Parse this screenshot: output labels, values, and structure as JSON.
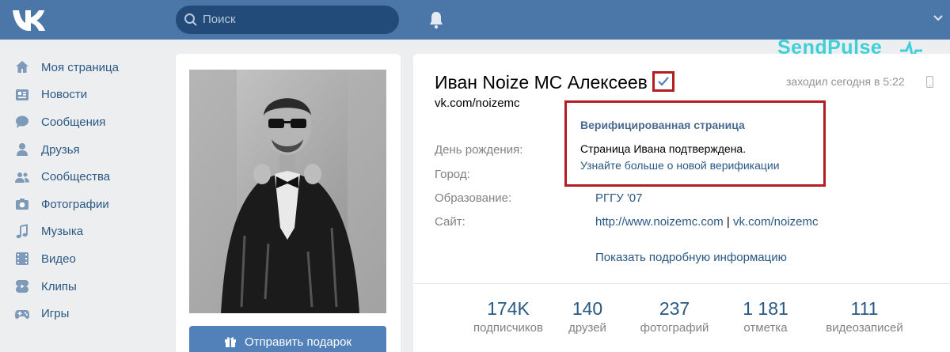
{
  "topbar": {
    "search_placeholder": "Поиск"
  },
  "sidebar": {
    "items": [
      {
        "label": "Моя страница",
        "icon": "home-icon"
      },
      {
        "label": "Новости",
        "icon": "news-icon"
      },
      {
        "label": "Сообщения",
        "icon": "messages-icon"
      },
      {
        "label": "Друзья",
        "icon": "friends-icon"
      },
      {
        "label": "Сообщества",
        "icon": "communities-icon"
      },
      {
        "label": "Фотографии",
        "icon": "camera-icon"
      },
      {
        "label": "Музыка",
        "icon": "music-icon"
      },
      {
        "label": "Видео",
        "icon": "video-icon"
      },
      {
        "label": "Клипы",
        "icon": "clips-icon"
      },
      {
        "label": "Игры",
        "icon": "gamepad-icon"
      }
    ]
  },
  "avatar": {
    "gift_button": "Отправить подарок"
  },
  "profile": {
    "name": "Иван Noize MC Алексеев",
    "last_seen": "заходил сегодня в 5:22",
    "short_link": "vk.com/noizemc",
    "info": {
      "birthday_label": "День рождения:",
      "city_label": "Город:",
      "education_label": "Образование:",
      "education_value": "РГГУ '07",
      "site_label": "Сайт:",
      "site_link_1": "http://www.noizemc.com",
      "site_sep": "|",
      "site_link_2": "vk.com/noizemc"
    },
    "show_more": "Показать подробную информацию",
    "stats": [
      {
        "num": "174K",
        "label": "подписчиков"
      },
      {
        "num": "140",
        "label": "друзей"
      },
      {
        "num": "237",
        "label": "фотографий"
      },
      {
        "num": "1 181",
        "label": "отметка"
      },
      {
        "num": "111",
        "label": "видеозаписей"
      }
    ]
  },
  "tooltip": {
    "title": "Верифицированная страница",
    "text": "Страница Ивана подтверждена.",
    "link": "Узнайте больше о новой верификации"
  },
  "watermark": {
    "text": "SendPulse"
  },
  "colors": {
    "topbar": "#4a76a8",
    "link": "#2a5885",
    "highlight_border": "#b21c23",
    "watermark": "#3ecfd8"
  }
}
